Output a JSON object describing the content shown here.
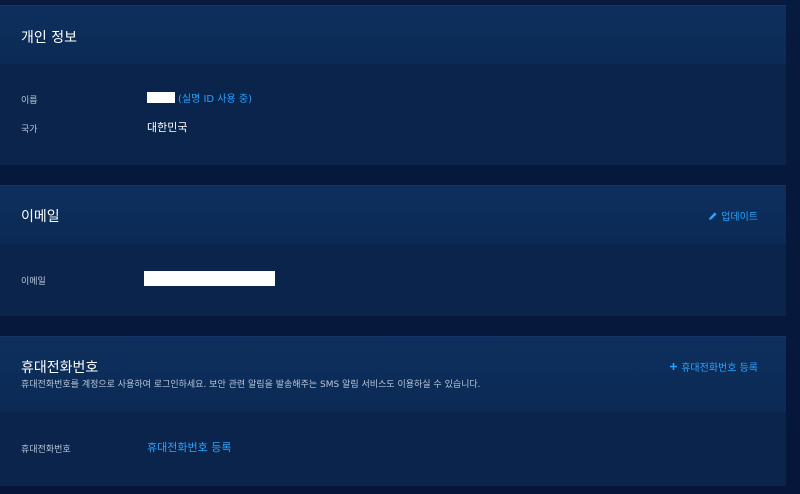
{
  "sections": {
    "personal": {
      "title": "개인 정보",
      "rows": [
        {
          "label": "이름",
          "note": "(실명 ID 사용 중)"
        },
        {
          "label": "국가",
          "value": "대한민국"
        }
      ]
    },
    "email": {
      "title": "이메일",
      "action_label": "업데이트",
      "action_icon": "pencil-icon",
      "rows": [
        {
          "label": "이메일"
        }
      ]
    },
    "phone": {
      "title": "휴대전화번호",
      "subtitle": "휴대전화번호를 계정으로 사용하여 로그인하세요. 보안 관련 알림을 발송해주는 SMS 알림 서비스도 이용하실 수 있습니다.",
      "action_label": "휴대전화번호 등록",
      "action_icon": "plus-icon",
      "rows": [
        {
          "label": "휴대전화번호",
          "link": "휴대전화번호 등록"
        }
      ]
    }
  },
  "colors": {
    "accent": "#2aa3ff",
    "panel": "#0b2955",
    "background": "#06183a"
  }
}
